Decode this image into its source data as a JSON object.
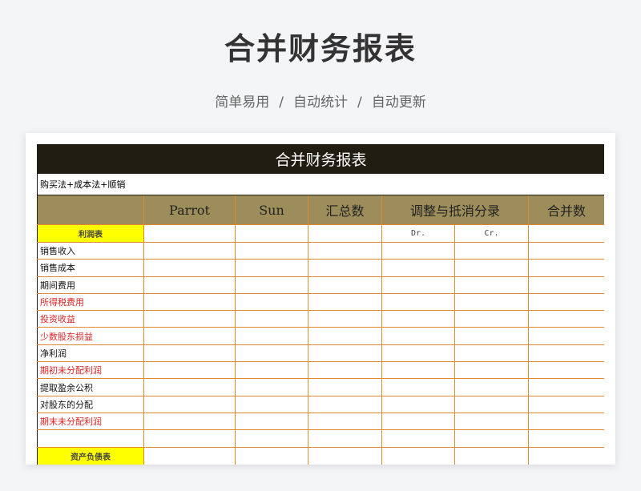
{
  "page": {
    "title": "合并财务报表",
    "subtitle_parts": [
      "简单易用",
      "自动统计",
      "自动更新"
    ],
    "separator": "/"
  },
  "sheet": {
    "title": "合并财务报表",
    "method": "购买法+成本法+顺销",
    "headers": {
      "parrot": "Parrot",
      "sun": "Sun",
      "total": "汇总数",
      "adjust": "调整与抵消分录",
      "merged": "合并数"
    },
    "subheaders": {
      "dr": "Dr.",
      "cr": "Cr."
    },
    "income_section": "利润表",
    "income_rows": [
      {
        "label": "销售收入",
        "red": false
      },
      {
        "label": "销售成本",
        "red": false
      },
      {
        "label": "期间费用",
        "red": false
      },
      {
        "label": "所得税费用",
        "red": true
      },
      {
        "label": "投资收益",
        "red": true
      },
      {
        "label": "少数股东损益",
        "red": true
      },
      {
        "label": "净利润",
        "red": false
      },
      {
        "label": "期初未分配利润",
        "red": true
      },
      {
        "label": "提取盈余公积",
        "red": false
      },
      {
        "label": "对股东的分配",
        "red": false
      },
      {
        "label": "期末未分配利润",
        "red": true
      },
      {
        "label": "",
        "red": false
      }
    ],
    "balance_section": "资产负债表"
  },
  "colors": {
    "title_bg": "#221d12",
    "header_bg": "#9c8d5a",
    "section_bg": "#ffff00",
    "grid": "#e08a2c",
    "red_text": "#e32222"
  }
}
